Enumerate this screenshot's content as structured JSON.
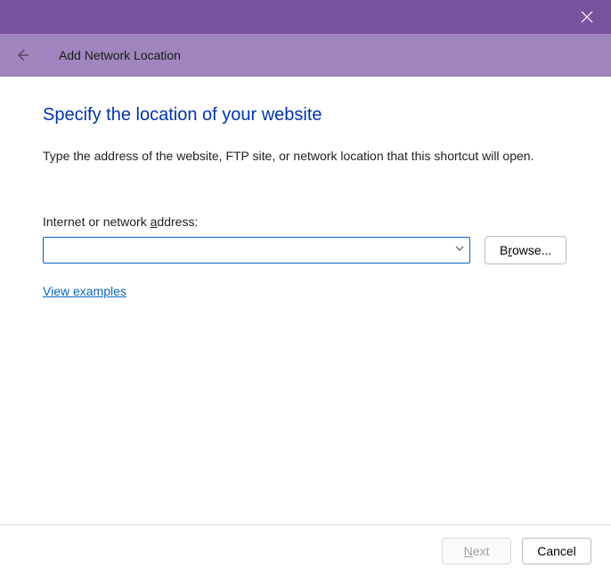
{
  "titlebar": {},
  "header": {
    "title": "Add Network Location"
  },
  "main": {
    "page_title": "Specify the location of your website",
    "description": "Type the address of the website, FTP site, or network location that this shortcut will open.",
    "address_label_pre": "Internet or network ",
    "address_label_key": "a",
    "address_label_post": "ddress:",
    "address_value": "",
    "browse_pre": "B",
    "browse_key": "r",
    "browse_post": "owse...",
    "examples_link": "View examples"
  },
  "footer": {
    "next_key": "N",
    "next_post": "ext",
    "cancel": "Cancel"
  }
}
